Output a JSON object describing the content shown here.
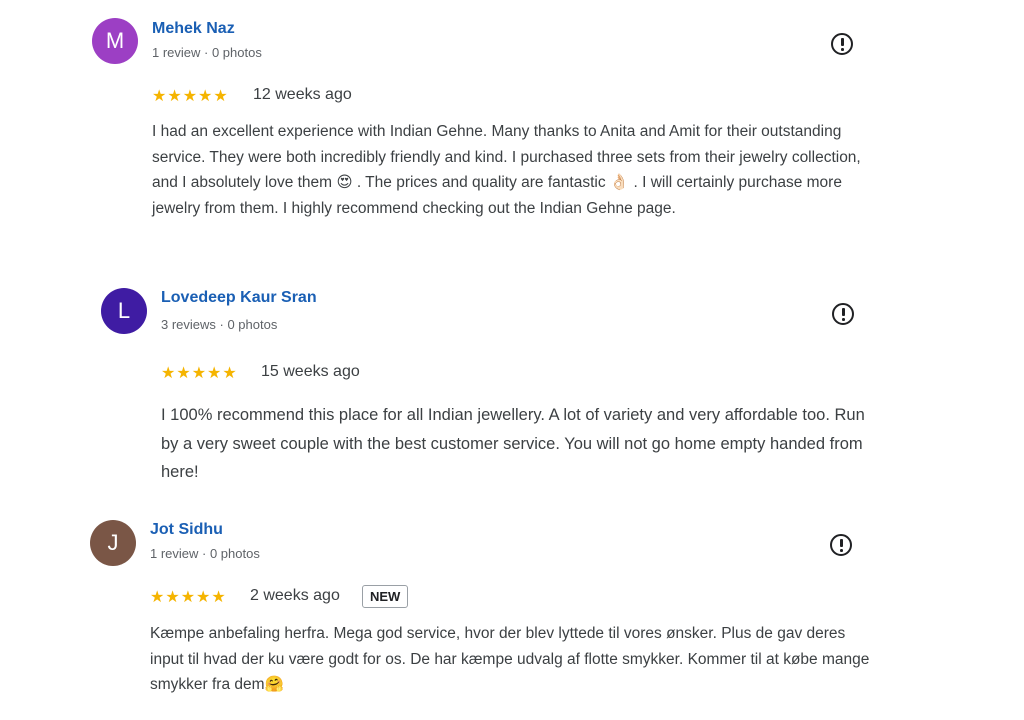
{
  "reviews": [
    {
      "avatar_letter": "M",
      "avatar_color": "#9c3fc4",
      "name": "Mehek Naz",
      "meta": "1 review · 0 photos",
      "stars": "★★★★★",
      "when": "12 weeks ago",
      "badge": "",
      "text": "I had an excellent experience with Indian Gehne. Many thanks to Anita and Amit for their outstanding service. They were both incredibly friendly and kind. I purchased three sets from their jewelry collection, and I absolutely love them 😍 . The prices and quality are fantastic 👌🏻 . I will certainly purchase more jewelry from them. I highly recommend checking out the Indian Gehne page."
    },
    {
      "avatar_letter": "L",
      "avatar_color": "#3f1ca3",
      "name": "Lovedeep Kaur Sran",
      "meta": "3 reviews · 0 photos",
      "stars": "★★★★★",
      "when": "15 weeks ago",
      "badge": "",
      "text": "I 100% recommend this place for all Indian jewellery. A lot of variety and very affordable too. Run by a very sweet couple with the best customer service. You will not go home empty handed from here!"
    },
    {
      "avatar_letter": "J",
      "avatar_color": "#7a5646",
      "name": "Jot Sidhu",
      "meta": "1 review · 0 photos",
      "stars": "★★★★★",
      "when": "2 weeks ago",
      "badge": "NEW",
      "text": "Kæmpe anbefaling herfra. Mega god service, hvor der blev lyttede til vores ønsker. Plus de gav deres input til hvad der ku være godt for os. De har kæmpe udvalg af flotte smykker. Kommer til at købe mange smykker fra dem🤗"
    }
  ],
  "icons": {
    "flag": "report-flag-icon",
    "star": "star-icon"
  }
}
